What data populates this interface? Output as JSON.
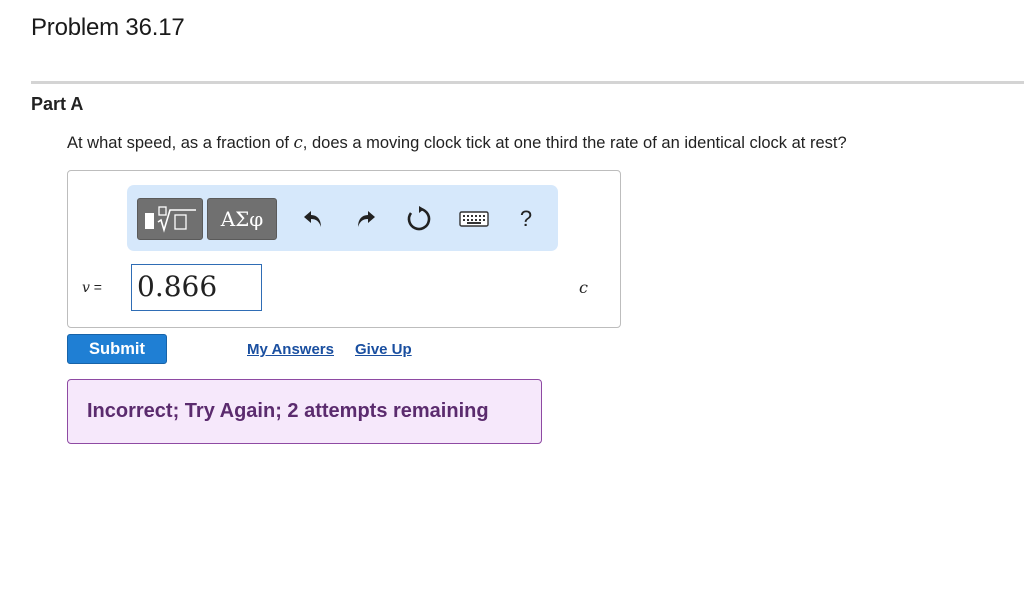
{
  "problem": {
    "title": "Problem 36.17"
  },
  "part": {
    "label": "Part A"
  },
  "question": {
    "before": "At what speed, as a fraction of ",
    "var": "c",
    "after": ", does a moving clock tick at one third the rate of an identical clock at rest?"
  },
  "toolbar": {
    "greek_label": "ΑΣφ",
    "help_label": "?",
    "icons": [
      "templates-icon",
      "undo-icon",
      "redo-icon",
      "reset-icon",
      "keyboard-icon",
      "help-icon"
    ]
  },
  "answer": {
    "var_name": "v",
    "equals": " =",
    "value": "0.866",
    "unit": "c"
  },
  "actions": {
    "submit_label": "Submit",
    "my_answers_label": "My Answers",
    "give_up_label": "Give Up"
  },
  "feedback": {
    "message": "Incorrect; Try Again; 2 attempts remaining"
  },
  "colors": {
    "accent": "#1f7fd4",
    "toolbar_bg": "#d6e8fb",
    "feedback_bg": "#f6e8fb",
    "feedback_text": "#5b2b6e",
    "link": "#1a4fa0"
  }
}
